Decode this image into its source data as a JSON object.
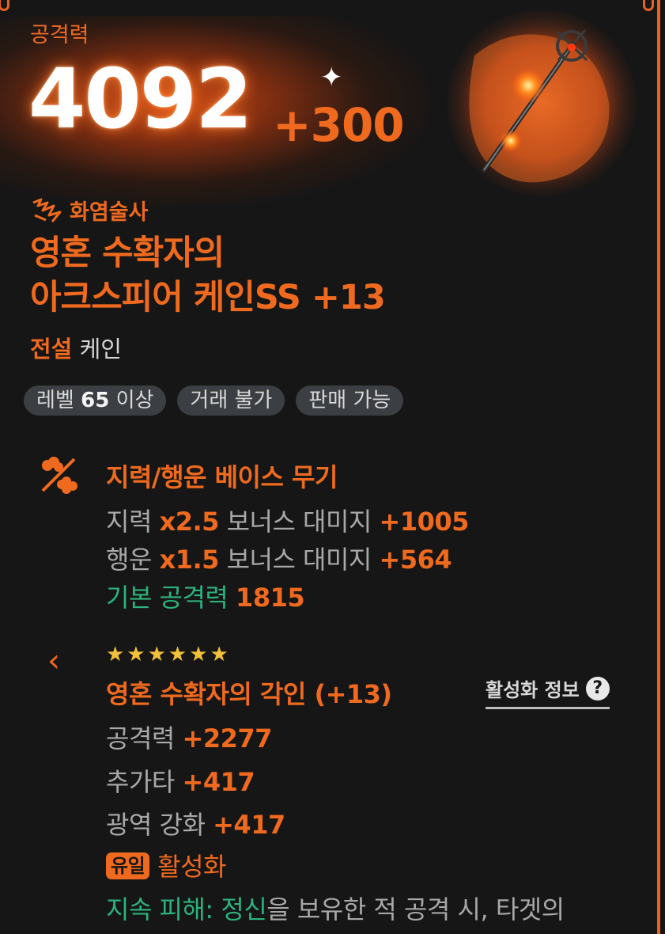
{
  "header": {
    "attack_label": "공격력",
    "attack_value": "4092",
    "attack_bonus": "+300"
  },
  "item": {
    "class_name": "화염술사",
    "name_line1": "영혼 수확자의",
    "name_line2": "아크스피어 케인SS +13",
    "rarity": "전설",
    "kind": "케인"
  },
  "tags": {
    "level_prefix": "레벨",
    "level_value": "65",
    "level_suffix": "이상",
    "trade": "거래 불가",
    "sell": "판매 가능"
  },
  "base_weapon": {
    "title": "지력/행운 베이스 무기",
    "int_label": "지력",
    "int_mult": "x2.5",
    "int_bonus_label": "보너스 대미지",
    "int_bonus": "+1005",
    "luk_label": "행운",
    "luk_mult": "x1.5",
    "luk_bonus_label": "보너스 대미지",
    "luk_bonus": "+564",
    "base_label": "기본 공격력",
    "base_value": "1815"
  },
  "engrave": {
    "stars": "★★★★★★",
    "title": "영혼 수확자의 각인 (+13)",
    "activation_info": "활성화 정보",
    "attack_label": "공격력",
    "attack_value": "+2277",
    "extra_hit_label": "추가타",
    "extra_hit_value": "+417",
    "area_label": "광역 강화",
    "area_value": "+417",
    "unique_badge": "유일",
    "unique_status": "활성화",
    "effect_prefix": "지속 피해: 정신",
    "effect_text": "을 보유한 적 공격 시, 타겟의"
  },
  "colors": {
    "accent": "#ef6a1e",
    "green": "#2cb37c",
    "star": "#f2c13a",
    "background": "#161616"
  },
  "icons": [
    "flame-class-icon",
    "int-luck-icon",
    "sparkle-icon",
    "chevron-left-icon",
    "question-icon"
  ]
}
